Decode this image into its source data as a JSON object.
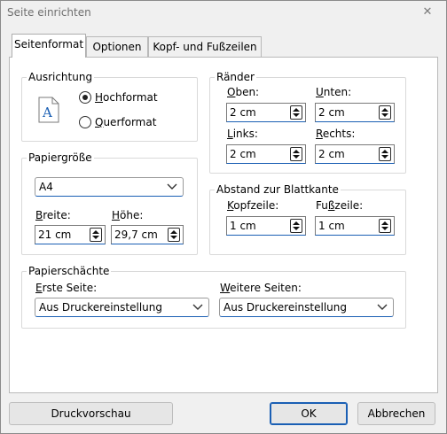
{
  "window": {
    "title": "Seite einrichten",
    "close_glyph": "✕"
  },
  "tabs": [
    {
      "label": "Seitenformat",
      "active": true
    },
    {
      "label": "Optionen",
      "active": false
    },
    {
      "label": "Kopf- und Fußzeilen",
      "active": false
    }
  ],
  "orientation": {
    "legend": "Ausrichtung",
    "icon": "portrait-page-icon",
    "portrait": {
      "label_u": "H",
      "label_rest": "ochformat",
      "selected": true
    },
    "landscape": {
      "label_u": "Q",
      "label_rest": "uerformat",
      "selected": false
    }
  },
  "margins": {
    "legend": "Ränder",
    "top": {
      "label_u": "O",
      "label_rest": "ben:",
      "value": "2 cm"
    },
    "bottom": {
      "label_u": "U",
      "label_rest": "nten:",
      "value": "2 cm"
    },
    "left": {
      "label_u": "L",
      "label_rest": "inks:",
      "value": "2 cm"
    },
    "right": {
      "label_u": "R",
      "label_rest": "echts:",
      "value": "2 cm"
    }
  },
  "paper_size": {
    "legend": "Papiergröße",
    "selected": "A4",
    "width": {
      "label_u": "B",
      "label_rest": "reite:",
      "value": "21 cm"
    },
    "height": {
      "label_u": "H",
      "label_rest": "öhe:",
      "value": "29,7 cm"
    }
  },
  "edge_distance": {
    "legend": "Abstand zur Blattkante",
    "header": {
      "label_u": "K",
      "label_rest": "opfzeile:",
      "value": "1 cm"
    },
    "footer": {
      "label_pre": "Fu",
      "label_u": "ß",
      "label_rest": "zeile:",
      "value": "1 cm"
    }
  },
  "paper_trays": {
    "legend": "Papierschächte",
    "first_page": {
      "label_u": "E",
      "label_rest": "rste Seite:",
      "value": "Aus Druckereinstellung"
    },
    "other_pages": {
      "label_u": "W",
      "label_rest": "eitere Seiten:",
      "value": "Aus Druckereinstellung"
    }
  },
  "buttons": {
    "preview": "Druckvorschau",
    "ok": "OK",
    "cancel": "Abbrechen"
  }
}
